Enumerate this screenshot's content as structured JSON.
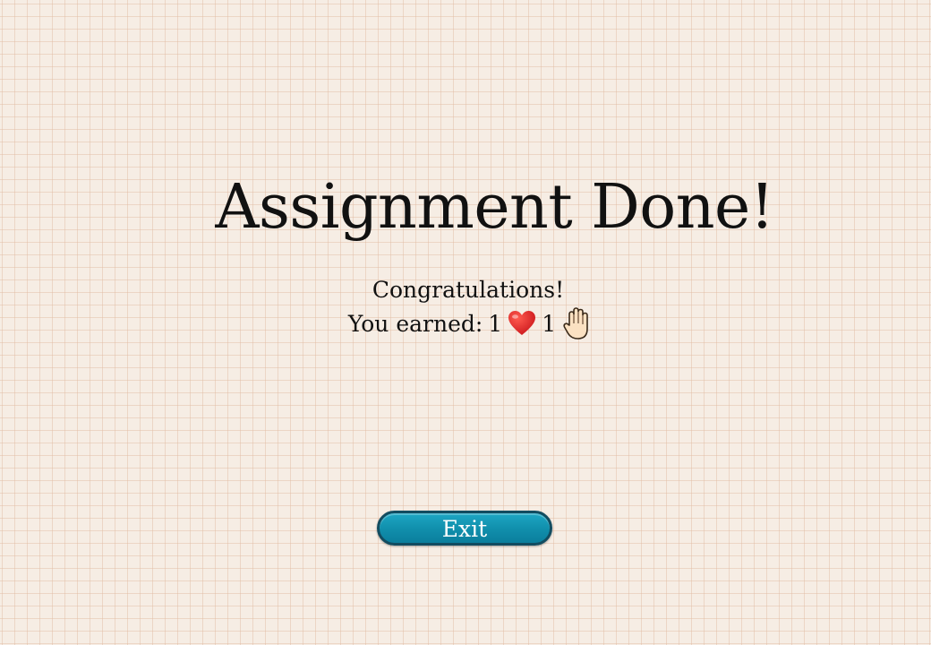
{
  "screen": {
    "title": "Assignment Done!",
    "congrats_text": "Congratulations!",
    "earned_label": "You earned: ",
    "hearts_count": "1",
    "hearts_icon": "heart-icon",
    "hands_count": "1",
    "hands_icon": "raised-hand-icon"
  },
  "exit_button": {
    "label": "Exit"
  },
  "colors": {
    "background": "#f6ede4",
    "grid_line": "#e1b9a0",
    "button_fill": "#1190ad",
    "button_border": "#124c60",
    "heart": "#e0201b"
  }
}
